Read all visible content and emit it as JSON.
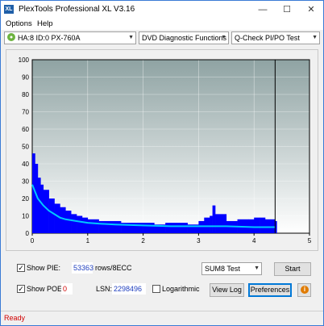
{
  "window": {
    "title": "PlexTools Professional XL V3.16",
    "icon_label": "XL",
    "min_glyph": "—",
    "max_glyph": "☐",
    "close_glyph": "✕"
  },
  "menu": {
    "options": "Options",
    "help": "Help"
  },
  "toolbar": {
    "drive": "HA:8 ID:0  PX-760A",
    "function": "DVD Diagnostic Functions",
    "test": "Q-Check PI/PO Test"
  },
  "chart_data": {
    "type": "bar",
    "xlim": [
      0,
      5
    ],
    "ylim": [
      0,
      100
    ],
    "x_ticks": [
      "0",
      "1",
      "2",
      "3",
      "4",
      "5"
    ],
    "y_ticks": [
      "0",
      "10",
      "20",
      "30",
      "40",
      "50",
      "60",
      "70",
      "80",
      "90",
      "100"
    ],
    "grid": true,
    "end_marker_x": 4.38,
    "series": [
      {
        "kind": "bars",
        "color": "#0000ff",
        "x": [
          0.0,
          0.05,
          0.1,
          0.15,
          0.2,
          0.3,
          0.4,
          0.5,
          0.6,
          0.7,
          0.8,
          0.9,
          1.0,
          1.2,
          1.4,
          1.6,
          1.8,
          2.0,
          2.2,
          2.4,
          2.6,
          2.8,
          3.0,
          3.1,
          3.2,
          3.25,
          3.3,
          3.5,
          3.7,
          3.9,
          4.0,
          4.1,
          4.2,
          4.3,
          4.38
        ],
        "y": [
          46,
          40,
          32,
          28,
          25,
          20,
          17,
          15,
          13,
          11,
          10,
          9,
          8,
          7,
          7,
          6,
          6,
          6,
          5,
          6,
          6,
          5,
          7,
          9,
          10,
          16,
          11,
          7,
          8,
          8,
          9,
          9,
          8,
          8,
          7
        ]
      },
      {
        "kind": "line",
        "color": "#00c8ff",
        "x": [
          0.0,
          0.05,
          0.1,
          0.2,
          0.3,
          0.4,
          0.5,
          0.6,
          0.8,
          1.0,
          1.2,
          1.5,
          2.0,
          2.5,
          3.0,
          3.5,
          4.0,
          4.38
        ],
        "y": [
          28,
          24,
          20,
          16,
          13,
          11,
          9,
          8,
          7,
          6,
          5.5,
          5,
          4.5,
          4,
          4,
          4,
          3.5,
          3.5
        ]
      }
    ]
  },
  "bottom": {
    "show_pie_label": "Show PIE:",
    "pie_value": "53363",
    "pie_unit": "rows/8ECC",
    "show_poe_label": "Show POE:",
    "poe_value": "0",
    "lsn_label": "LSN:",
    "lsn_value": "2298496",
    "logarithmic_label": "Logarithmic",
    "sum_select": "SUM8 Test",
    "start_label": "Start",
    "view_log_label": "View Log",
    "preferences_label": "Preferences",
    "help_glyph": "i",
    "check_glyph": "✓"
  },
  "status": {
    "text": "Ready"
  }
}
